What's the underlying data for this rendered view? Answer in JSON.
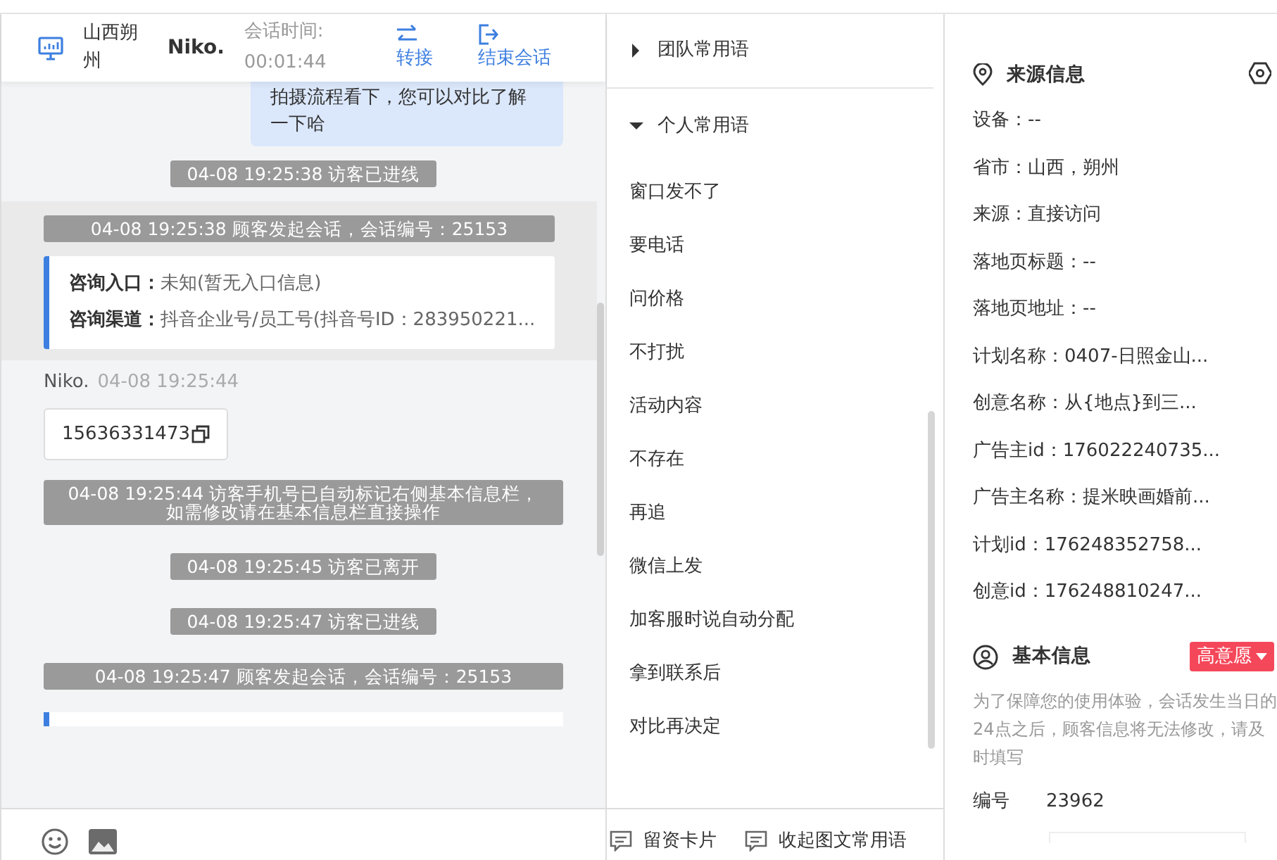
{
  "header": {
    "location": "山西朔州",
    "agent": "Niko.",
    "duration_label": "会话时间:",
    "duration": "00:01:44",
    "actions": [
      {
        "label": "转接",
        "kind": "transfer"
      },
      {
        "label": "结束会话",
        "kind": "end"
      }
    ]
  },
  "messages": [
    {
      "kind": "bubble",
      "text": "拍摄流程看下，您可以对比了解一下哈"
    },
    {
      "kind": "system",
      "text": "04-08 19:25:38 访客已进线",
      "highlighted": false
    },
    {
      "kind": "system",
      "text": "04-08 19:25:38 顾客发起会话，会话编号：25153",
      "highlighted": true
    },
    {
      "kind": "info",
      "highlighted": true,
      "lines": [
        {
          "label": "咨询入口：",
          "value": "未知(暂无入口信息)"
        },
        {
          "label": "咨询渠道：",
          "value": "抖音企业号/员工号(抖音号ID：283950221..."
        }
      ]
    },
    {
      "kind": "contact",
      "sender": "Niko.",
      "time": "04-08 19:25:44",
      "text": "15636331473"
    },
    {
      "kind": "system",
      "text": "04-08 19:25:44 访客手机号已自动标记右侧基本信息栏，如需修改请在基本信息栏直接操作",
      "highlighted": false
    },
    {
      "kind": "system",
      "text": "04-08 19:25:45 访客已离开",
      "highlighted": false
    },
    {
      "kind": "system",
      "text": "04-08 19:25:47 访客已进线",
      "highlighted": false
    },
    {
      "kind": "system",
      "text": "04-08 19:25:47 顾客发起会话，会话编号：25153",
      "highlighted": false
    },
    {
      "kind": "info_cut",
      "highlighted": false
    }
  ],
  "phrases": {
    "groups": [
      {
        "title": "团队常用语",
        "expanded": false
      },
      {
        "title": "个人常用语",
        "expanded": true,
        "items": [
          "窗口发不了",
          "要电话",
          "问价格",
          "不打扰",
          "活动内容",
          "不存在",
          "再追",
          "微信上发",
          "加客服时说自动分配",
          "拿到联系后",
          "对比再决定"
        ]
      }
    ],
    "footer": [
      "留资卡片",
      "收起图文常用语"
    ]
  },
  "source": {
    "title": "来源信息",
    "fields": [
      "设备：--",
      "省市：山西，朔州",
      "来源：直接访问",
      "落地页标题：--",
      "落地页地址：--",
      "计划名称：0407-日照金山...",
      "创意名称：从{地点}到三...",
      "广告主id：176022240735...",
      "广告主名称：提米映画婚前...",
      "计划id：176248352758...",
      "创意id：176248810247..."
    ]
  },
  "basic": {
    "title": "基本信息",
    "intent": "高意愿",
    "notice": "为了保障您的使用体验，会话发生当日的24点之后，顾客信息将无法修改，请及时填写",
    "fields": [
      {
        "label": "编号",
        "value": "23962"
      }
    ]
  }
}
